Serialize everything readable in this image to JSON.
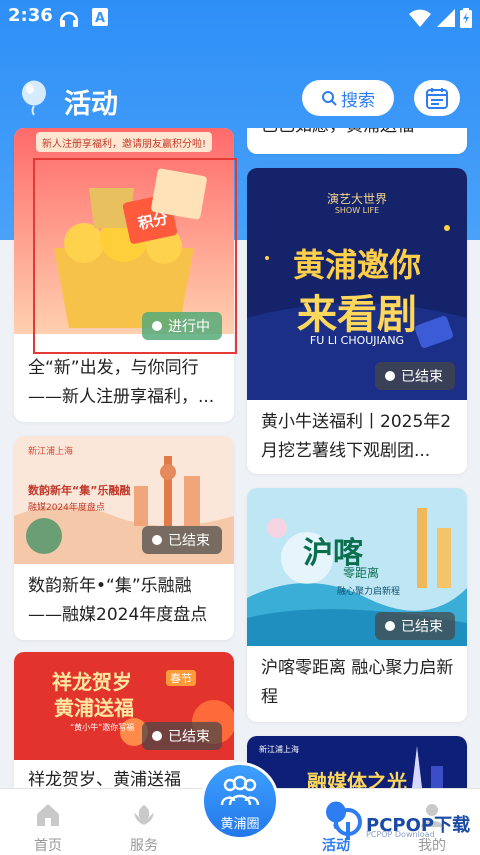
{
  "status_bar": {
    "time": "2:36"
  },
  "header": {
    "title": "活动",
    "search_label": "搜索"
  },
  "cards": [
    {
      "title": "全“新”出发，与你同行——新人注册享福利，...",
      "status": "进行中",
      "banner_text": "新人注册享福利，邀请朋友赢积分啦!",
      "sticker": "积分"
    },
    {
      "title": "黄小牛送福利丨2025年2月挖艺薯线下观剧团...",
      "status": "已结束",
      "poster_line1": "黄浦邀你",
      "poster_line2": "来看剧",
      "poster_sub": "FU LI CHOUJIANG",
      "poster_logo": "演艺大世界",
      "poster_logo_sub": "SHOW LIFE"
    },
    {
      "title": "数韵新年•“集”乐融融——融媒2024年度盘点",
      "status": "已结束",
      "poster_line1": "数韵新年“集”乐融融",
      "poster_line2": "融媒2024年度盘点",
      "poster_top": "新江浦上海"
    },
    {
      "title": "沪喀零距离 融心聚力启新程",
      "status": "已结束",
      "poster_line1": "沪喀",
      "poster_line2": "零距离",
      "poster_sub": "融心聚力启新程"
    },
    {
      "title": "祥龙贺岁、黄浦送福",
      "status": "已结束",
      "poster_line1": "祥龙贺岁",
      "poster_line2": "黄浦送福",
      "poster_tag": "春节",
      "poster_sub": "“黄小牛”邀你写福"
    },
    {
      "title": "",
      "status": "",
      "poster_line1": "融媒体之光",
      "poster_top": "新江浦上海"
    }
  ],
  "top_partial_title": "已已如愿，黄浦送福",
  "tabs": [
    {
      "label": "首页"
    },
    {
      "label": "服务"
    },
    {
      "label": "黄浦圈"
    },
    {
      "label": "活动"
    },
    {
      "label": "我的"
    }
  ],
  "watermark": {
    "text": "PCPOP下载",
    "sub": "PCPOP Download"
  },
  "colors": {
    "accent": "#2e7cf2",
    "header_bg": "#3b97f7",
    "badge_live": "#56aa78",
    "badge_ended": "#555555",
    "highlight_box": "#e53935"
  }
}
